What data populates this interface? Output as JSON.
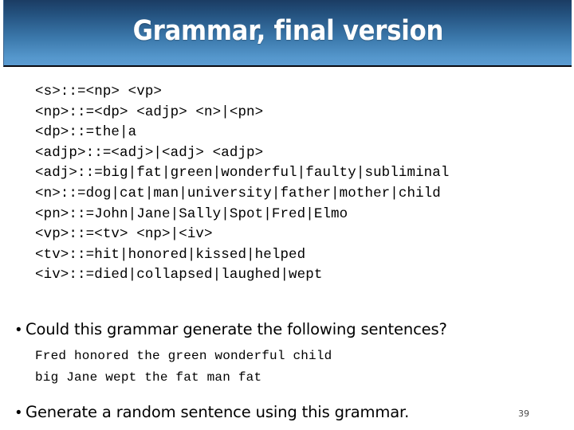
{
  "slide": {
    "title": "Grammar, final version",
    "page_number": "39"
  },
  "grammar": {
    "rules": [
      "<s>::=<np> <vp>",
      "<np>::=<dp> <adjp> <n>|<pn>",
      "<dp>::=the|a",
      "<adjp>::=<adj>|<adj> <adjp>",
      "<adj>::=big|fat|green|wonderful|faulty|subliminal",
      "<n>::=dog|cat|man|university|father|mother|child",
      "<pn>::=John|Jane|Sally|Spot|Fred|Elmo",
      "<vp>::=<tv> <np>|<iv>",
      "<tv>::=hit|honored|kissed|helped",
      "<iv>::=died|collapsed|laughed|wept"
    ]
  },
  "bullets": {
    "question": "Could this grammar generate the following sentences?",
    "generate": "Generate a random sentence using this grammar."
  },
  "examples": [
    "Fred honored the green wonderful child",
    "big Jane wept the fat man fat"
  ],
  "colors": {
    "banner_top": "#1b3c63",
    "banner_bottom": "#5b9bd1",
    "banner_border": "#0a0a10",
    "title_text": "#ffffff",
    "body_text": "#000000",
    "page_number_text": "#4a4a4a",
    "background": "#ffffff"
  }
}
